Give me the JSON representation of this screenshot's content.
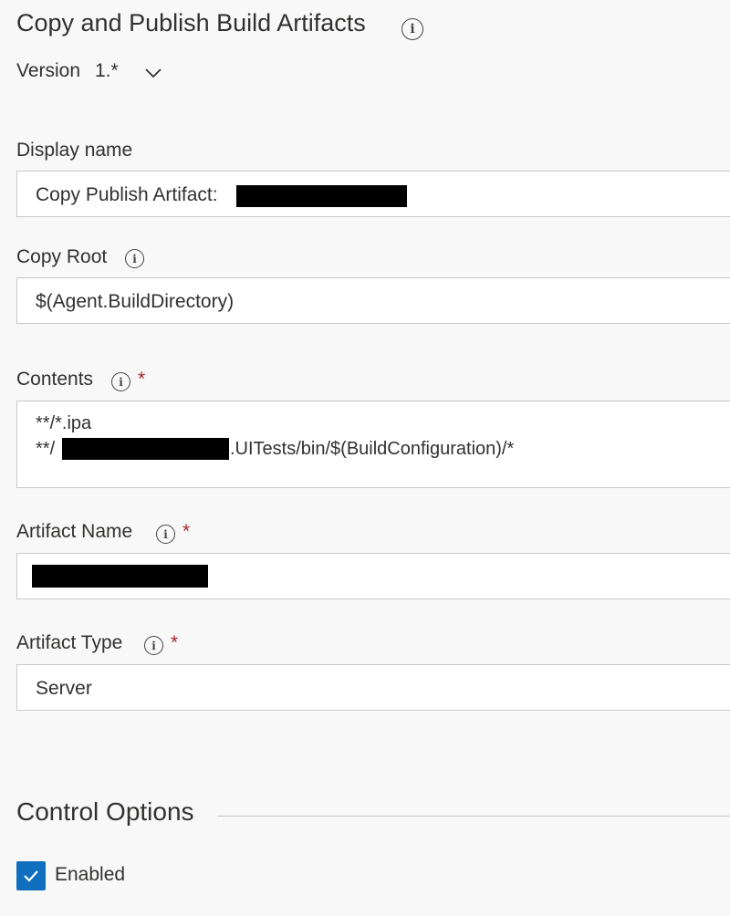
{
  "task": {
    "title": "Copy and Publish Build Artifacts",
    "version_label": "Version",
    "version_value": "1.*"
  },
  "fields": {
    "display_name": {
      "label": "Display name",
      "value": "Copy Publish Artifact: "
    },
    "copy_root": {
      "label": "Copy Root",
      "value": "$(Agent.BuildDirectory)"
    },
    "contents": {
      "label": "Contents",
      "required_mark": "*",
      "line1": "**/*.ipa",
      "line2_prefix": "**/",
      "line2_suffix": ".UITests/bin/$(BuildConfiguration)/*"
    },
    "artifact_name": {
      "label": "Artifact Name",
      "required_mark": "*"
    },
    "artifact_type": {
      "label": "Artifact Type",
      "required_mark": "*",
      "value": "Server"
    }
  },
  "control_options": {
    "title": "Control Options",
    "enabled_label": "Enabled",
    "enabled_checked": true
  },
  "icons": {
    "info": "info-icon",
    "chevron": "chevron-down-icon",
    "check": "checkmark-icon"
  },
  "colors": {
    "accent": "#106ebe",
    "required": "#a4262c",
    "background": "#f8f8f8",
    "input_border": "#c8c8c8"
  }
}
